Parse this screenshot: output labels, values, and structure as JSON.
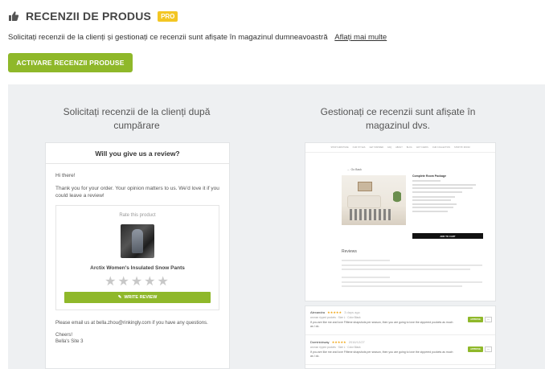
{
  "header": {
    "icon": "thumbs-up-icon",
    "title": "RECENZII DE PRODUS",
    "badge": "PRO"
  },
  "description": {
    "text": "Solicitați recenzii de la clienți și gestionați ce recenzii sunt afișate în magazinul dumneavoastră",
    "link": "Aflați mai multe"
  },
  "activate_button": "ACTIVARE RECENZII PRODUSE",
  "left_column": {
    "title": "Solicitați recenzii de la clienți după cumpărare",
    "email": {
      "heading": "Will you give us a review?",
      "greeting": "Hi there!",
      "intro": "Thank you for your order. Your opinion matters to us. We'd love it if you could leave a review!",
      "rate_label": "Rate this product",
      "product_name": "Arctix Women's Insulated Snow Pants",
      "stars": "★★★★★",
      "write_review": "WRITE REVIEW",
      "footer_email": "Please email us at bella.zhou@rinkingly.com if you have any questions.",
      "sign_off": "Cheers!",
      "signature": "Bella's Site 3"
    }
  },
  "right_column": {
    "title": "Gestionați ce recenzii sunt afișate în magazinul dvs.",
    "store": {
      "nav": [
        "SHOP FURNITURE",
        "OUR STYLES",
        "GET INSPIRED",
        "FAQ",
        "ABOUT",
        "BLOG",
        "GIFT CARDS",
        "OUR COLLECTION",
        "SHOP BY ROOM"
      ],
      "back": "← Go Back",
      "product_title": "Complete Room Package",
      "add_to_cart": "ADD TO CART",
      "reviews_heading": "Reviews"
    },
    "admin_reviews": [
      {
        "name": "Alexandra",
        "stars": "★★★★★",
        "date": "3 days ago",
        "meta": "woman ripped pockets · Size L · Color Black",
        "text": "If you are like me and love Fiftene shapshots per season, then you are going to love the zippered pockets as much as I do.",
        "approve": "APPROVE",
        "more": "···"
      },
      {
        "name": "Dominickway",
        "stars": "★★★★★",
        "date": "2016/12/27",
        "meta": "woman ripped pockets · Size L · Color Black",
        "text": "If you are like me and love Fiftene shapshots per season, then you are going to love the zippered pockets as much as I do.",
        "approve": "APPROVE",
        "more": "···"
      }
    ]
  }
}
